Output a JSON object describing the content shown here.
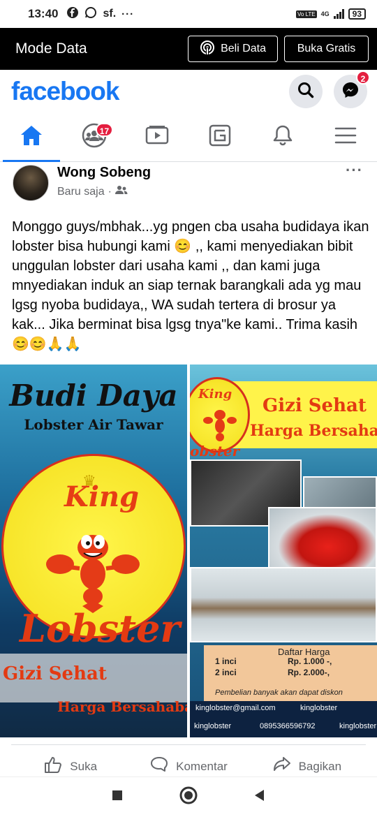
{
  "status_bar": {
    "time": "13:40",
    "left_icons": [
      "facebook-icon",
      "whatsapp-icon",
      "sf-icon",
      "more-icon"
    ],
    "network": "4G",
    "lte": "Vo LTE",
    "battery": "93"
  },
  "data_mode": {
    "title": "Mode Data",
    "buy_data_label": "Beli Data",
    "free_mode_label": "Buka Gratis"
  },
  "header": {
    "logo": "facebook",
    "messenger_badge": "2"
  },
  "nav": {
    "tabs": [
      "home",
      "groups",
      "watch",
      "pages",
      "notifications",
      "menu"
    ],
    "groups_badge": "17",
    "active": "home"
  },
  "post": {
    "author": "Wong Sobeng",
    "time": "Baru saja",
    "privacy_icon": "friends-icon",
    "text": "Monggo guys/mbhak...yg pngen cba usaha budidaya ikan lobster bisa hubungi kami 😊 ,, kami menyediakan bibit unggulan lobster dari usaha kami ,, dan kami juga mnyediakan induk an siap ternak barangkali ada yg mau lgsg nyoba budidaya,, WA sudah tertera di brosur ya kak... Jika berminat bisa lgsg tnya\"ke kami.. Trima kasih😊😊🙏🙏",
    "image_left": {
      "title": "Budi Daya",
      "subtitle": "Lobster Air Tawar",
      "brand_top": "King",
      "brand_bottom": "Lobster",
      "tagline1": "Gizi Sehat",
      "tagline2": "Harga Bersahaba"
    },
    "image_right": {
      "brand_top": "King",
      "brand_bottom": "obster",
      "tagline1": "Gizi Sehat",
      "tagline2": "Harga Bersahaba",
      "price_title": "Daftar Harga",
      "prices": [
        {
          "size": "1 inci",
          "price": "Rp. 1.000 -,"
        },
        {
          "size": "2 inci",
          "price": "Rp. 2.000-,"
        }
      ],
      "discount_note": "Pembelian banyak akan dapat diskon",
      "email": "kinglobster@gmail.com",
      "facebook": "kinglobster",
      "instagram": "kinglobster",
      "phone": "0895366596792",
      "web": "kinglobster"
    }
  },
  "actions": {
    "like": "Suka",
    "comment": "Komentar",
    "share": "Bagikan"
  },
  "android_nav": [
    "recents-button",
    "home-button",
    "back-button"
  ]
}
